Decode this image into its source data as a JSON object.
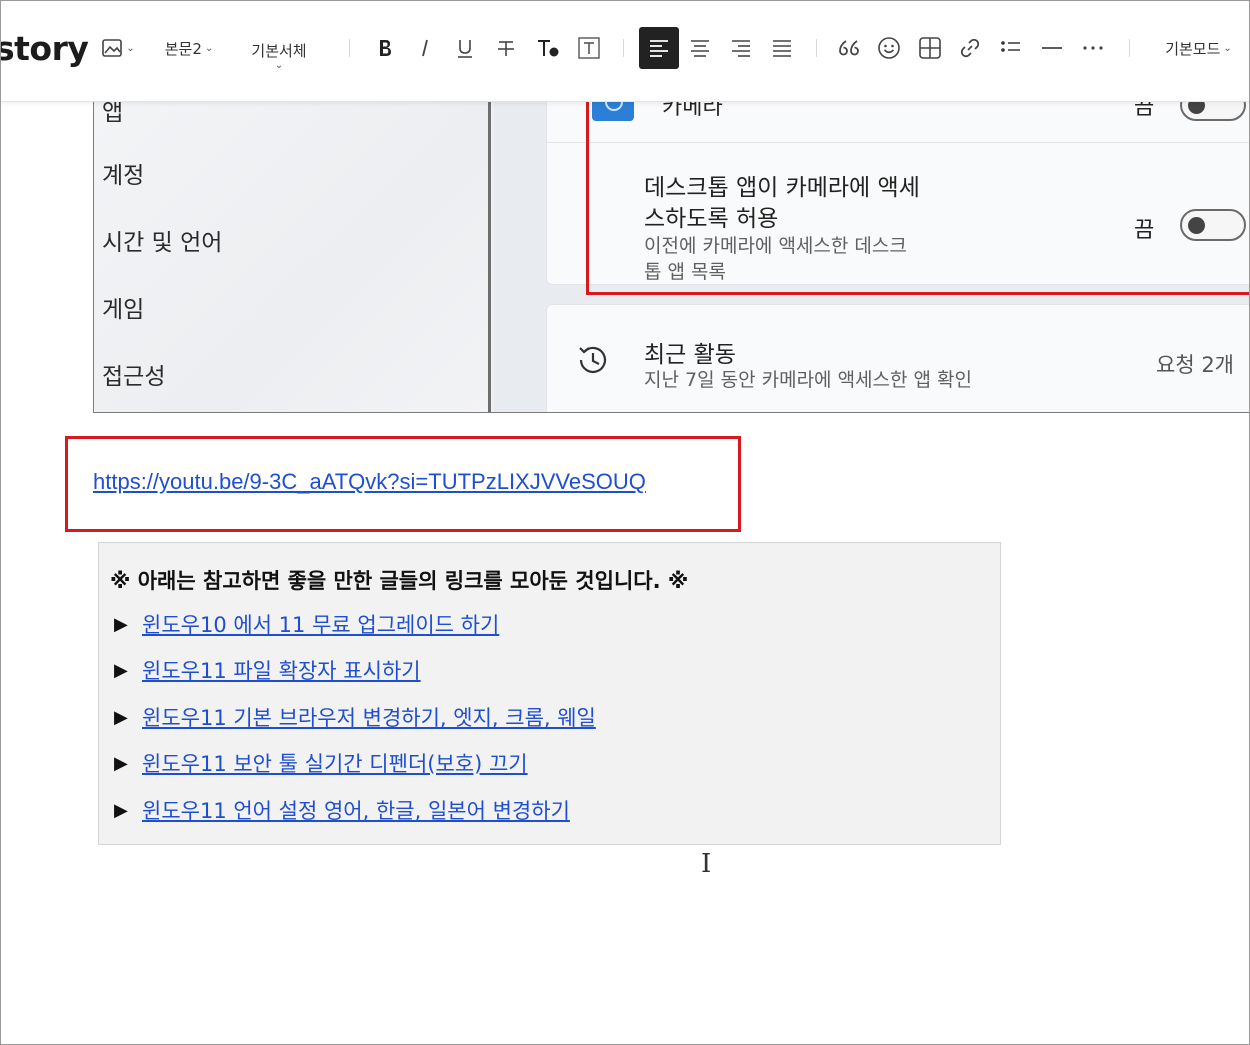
{
  "toolbar": {
    "logo": "story",
    "paragraph_style": "본문2",
    "font_family": "기본서체",
    "mode": "기본모드",
    "font_caret": "⌄"
  },
  "screenshot": {
    "sidebar_items": [
      "앱",
      "계정",
      "시간 및 언어",
      "게임",
      "접근성"
    ],
    "camera_label": "카메라",
    "camera_state": "끔",
    "desktop_title_line1": "데스크톱 앱이 카메라에 액세",
    "desktop_title_line2": "스하도록 허용",
    "desktop_sub_line1": "이전에 카메라에 액세스한 데스크",
    "desktop_sub_line2": "톱 앱 목록",
    "desktop_state": "끔",
    "recent_title": "최근 활동",
    "recent_sub": "지난 7일 동안 카메라에 액세스한 앱 확인",
    "recent_count": "요청 2개"
  },
  "url": "https://youtu.be/9-3C_aATQvk?si=TUTPzLIXJVVeSOUQ",
  "reference": {
    "heading": "※ 아래는 참고하면 좋을 만한 글들의 링크를 모아둔 것입니다. ※",
    "links": [
      "윈도우10 에서 11 무료 업그레이드 하기",
      "윈도우11 파일 확장자 표시하기",
      "윈도우11 기본 브라우저 변경하기, 엣지, 크롬, 웨일",
      "윈도우11 보안 툴 실기간 디펜더(보호) 끄기",
      "윈도우11 언어 설정 영어, 한글, 일본어 변경하기"
    ]
  }
}
